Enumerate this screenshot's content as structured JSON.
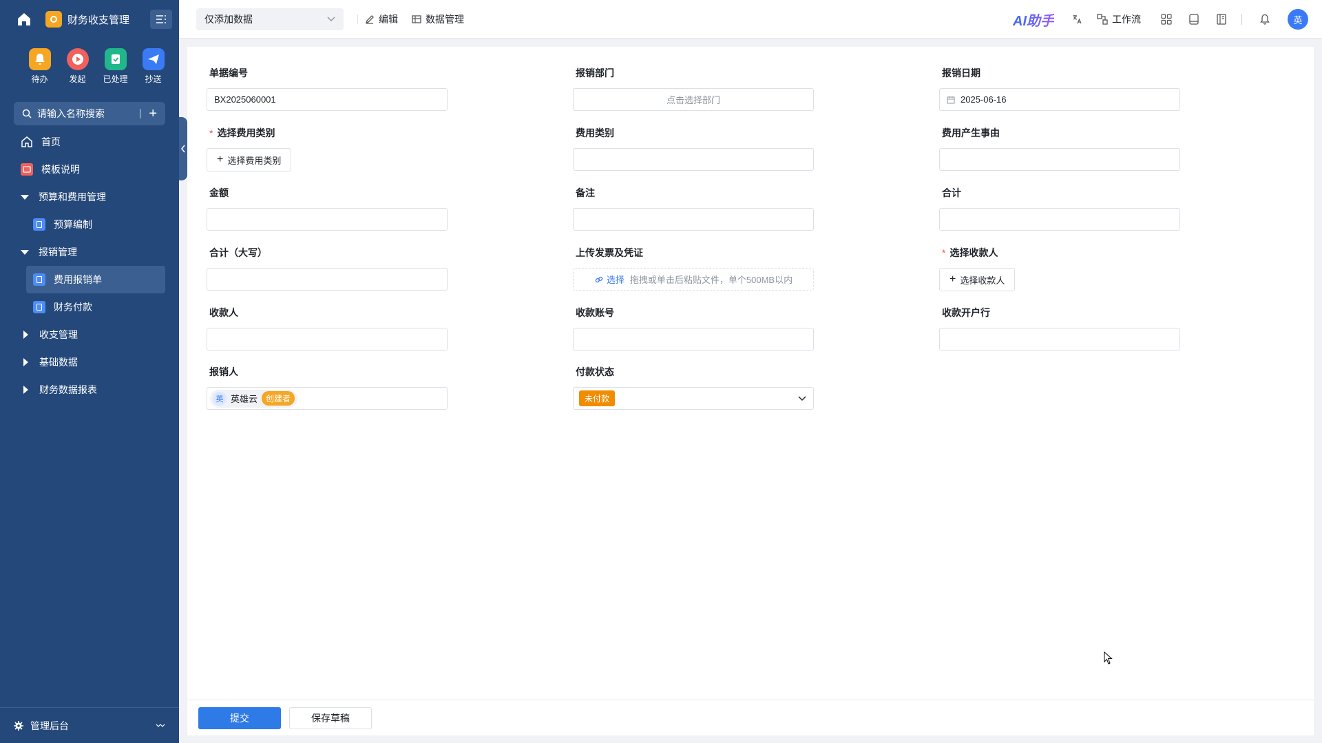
{
  "sidebar": {
    "app_title": "财务收支管理",
    "quick": [
      {
        "label": "待办",
        "icon": "bell-icon",
        "color": "#f5a623"
      },
      {
        "label": "发起",
        "icon": "play-icon",
        "color": "#f0605d"
      },
      {
        "label": "已处理",
        "icon": "check-doc-icon",
        "color": "#20b78a"
      },
      {
        "label": "抄送",
        "icon": "send-icon",
        "color": "#3a7bf5"
      }
    ],
    "search_placeholder": "请输入名称搜索",
    "nav": [
      {
        "label": "首页"
      },
      {
        "label": "模板说明"
      },
      {
        "label": "预算和费用管理"
      },
      {
        "label": "预算编制"
      },
      {
        "label": "报销管理"
      },
      {
        "label": "费用报销单"
      },
      {
        "label": "财务付款"
      },
      {
        "label": "收支管理"
      },
      {
        "label": "基础数据"
      },
      {
        "label": "财务数据报表"
      }
    ],
    "footer_label": "管理后台"
  },
  "topbar": {
    "view_select": "仅添加数据",
    "edit": "编辑",
    "data_manage": "数据管理",
    "ai_label": "AI助手",
    "workflow": "工作流",
    "avatar": "英"
  },
  "form": {
    "bill_no": {
      "label": "单据编号",
      "value": "BX2025060001"
    },
    "dept": {
      "label": "报销部门",
      "placeholder": "点击选择部门"
    },
    "date": {
      "label": "报销日期",
      "value": "2025-06-16"
    },
    "fee_type_pick": {
      "label": "选择费用类别",
      "button": "选择费用类别"
    },
    "fee_type": {
      "label": "费用类别",
      "value": ""
    },
    "reason": {
      "label": "费用产生事由",
      "value": ""
    },
    "amount": {
      "label": "金额",
      "value": ""
    },
    "remark": {
      "label": "备注",
      "value": ""
    },
    "total": {
      "label": "合计",
      "value": ""
    },
    "total_upper": {
      "label": "合计（大写）",
      "value": ""
    },
    "upload": {
      "label": "上传发票及凭证",
      "link": "选择",
      "hint": "拖拽或单击后粘贴文件，单个500MB以内"
    },
    "payee_pick": {
      "label": "选择收款人",
      "button": "选择收款人"
    },
    "payee": {
      "label": "收款人",
      "value": ""
    },
    "account": {
      "label": "收款账号",
      "value": ""
    },
    "bank": {
      "label": "收款开户行",
      "value": ""
    },
    "applicant": {
      "label": "报销人",
      "avatar": "英",
      "name": "英雄云",
      "tag": "创建者"
    },
    "pay_status": {
      "label": "付款状态",
      "value": "未付款"
    }
  },
  "footer": {
    "submit": "提交",
    "save_draft": "保存草稿"
  },
  "colors": {
    "sidebar_bg": "#24487a",
    "primary": "#2e7ae6",
    "required": "#f54a45",
    "status_orange": "#f08c00"
  }
}
